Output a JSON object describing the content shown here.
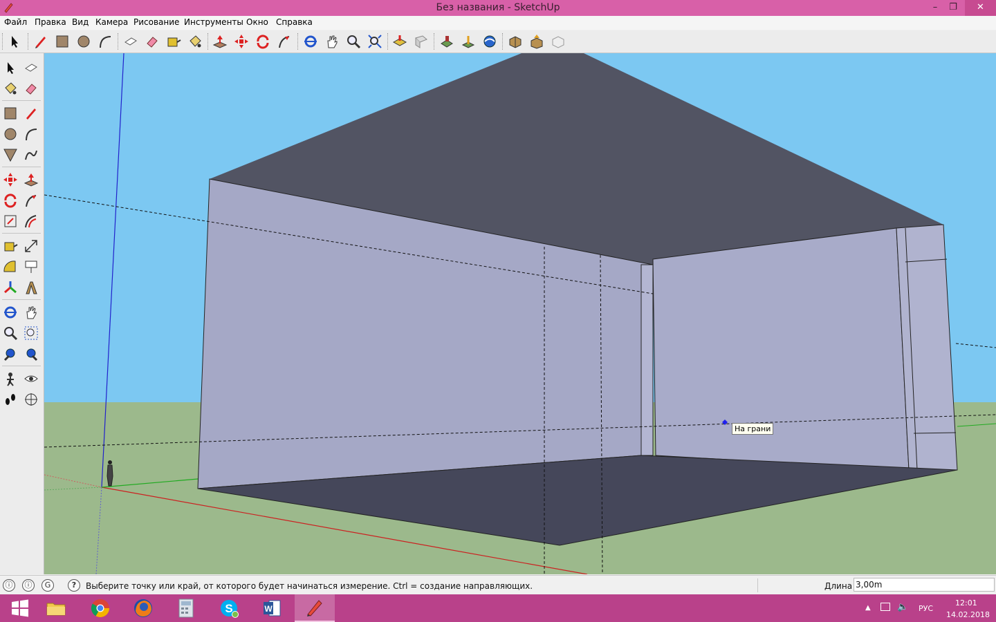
{
  "window": {
    "title": "Без названия - SketchUp",
    "controls": {
      "minimize": "–",
      "restore": "❐",
      "close": "✕"
    }
  },
  "menu": [
    "Файл",
    "Правка",
    "Вид",
    "Камера",
    "Рисование",
    "Инструменты",
    "Окно",
    "Справка"
  ],
  "toolbar": {
    "icons": [
      "select-icon",
      "pencil-icon",
      "rectangle-icon",
      "circle-icon",
      "arc-icon",
      "make-component-icon",
      "eraser-icon",
      "tape-measure-icon",
      "paint-bucket-icon",
      "push-pull-icon",
      "move-icon",
      "rotate-icon",
      "follow-me-icon",
      "orbit-icon",
      "pan-icon",
      "zoom-icon",
      "zoom-extents-icon",
      "get-models-icon",
      "share-model-icon",
      "warehouse-component-icon",
      "add-location-icon",
      "preview-earth-icon",
      "get-extensions-icon",
      "upload-icon",
      "extension-warehouse-icon"
    ]
  },
  "palette": {
    "icons": [
      "select-icon",
      "make-component-icon",
      "paint-bucket-icon",
      "eraser-icon",
      "rectangle-icon",
      "line-icon",
      "circle-icon",
      "arc-icon",
      "polygon-icon",
      "freehand-icon",
      "move-icon",
      "push-pull-icon",
      "rotate-icon",
      "follow-me-icon",
      "scale-icon",
      "offset-icon",
      "tape-measure-icon",
      "dimension-icon",
      "protractor-icon",
      "text-icon",
      "axes-icon",
      "3d-text-icon",
      "orbit-icon",
      "pan-icon",
      "zoom-icon",
      "zoom-window-icon",
      "previous-view-icon",
      "zoom-extents-icon",
      "position-camera-icon",
      "look-around-icon",
      "walk-icon",
      "section-plane-icon"
    ]
  },
  "viewport": {
    "tooltip": "На грани",
    "colors": {
      "sky": "#7cc8f2",
      "ground": "#9cb98c",
      "wall": "#a5a8c6",
      "ceiling": "#525463",
      "floor": "#45475a"
    }
  },
  "status": {
    "text": "Выберите точку или край, от которого будет начинаться измерение.  Ctrl = создание направляющих.",
    "measure_label": "Длина",
    "measure_value": "3,00m",
    "help_icon": "?"
  },
  "taskbar": {
    "apps": [
      "windows-start-icon",
      "file-explorer-icon",
      "chrome-icon",
      "firefox-icon",
      "calculator-icon",
      "skype-icon",
      "word-icon",
      "sketchup-icon"
    ],
    "language": "РУС",
    "time": "12:01",
    "date": "14.02.2018"
  }
}
